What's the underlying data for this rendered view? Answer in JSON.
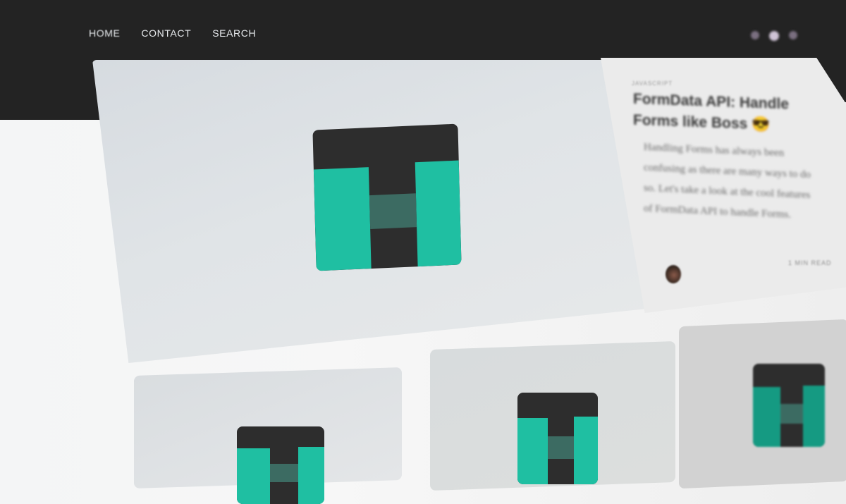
{
  "nav": {
    "items": [
      {
        "label": "HOME"
      },
      {
        "label": "CONTACT"
      },
      {
        "label": "SEARCH"
      }
    ],
    "social_icons": [
      "social-icon-1",
      "social-icon-2",
      "social-icon-3"
    ]
  },
  "featured_post": {
    "category": "JAVASCRIPT",
    "title": "FormData API: Handle Forms like Boss 😎",
    "excerpt": "Handling Forms has always been confusing as there are many ways to do so. Let's take a look at the cool features of FormData API to handle Forms.",
    "read_time": "1 MIN READ",
    "logo_icon": "logo-t-icon"
  },
  "colors": {
    "header_bg": "#232323",
    "accent_teal": "#1fbfa2",
    "logo_dark": "#2d2d2d",
    "logo_mid": "#3c6b62"
  }
}
